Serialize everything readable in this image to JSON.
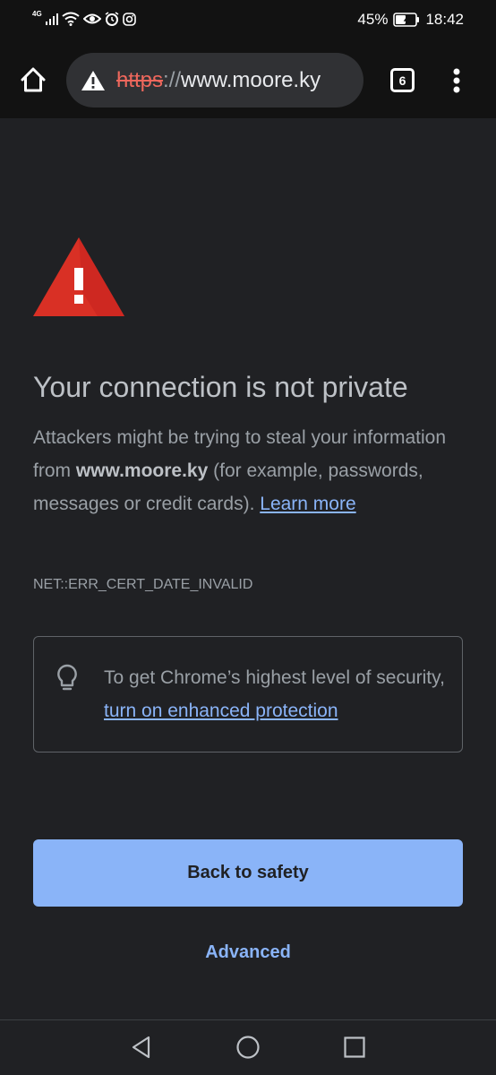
{
  "status_bar": {
    "network_type": "4G",
    "battery": "45%",
    "time": "18:42"
  },
  "toolbar": {
    "url_scheme": "https",
    "url_separator": "://",
    "url_host": "www.moore.ky",
    "tab_count": "6"
  },
  "page": {
    "heading": "Your connection is not private",
    "body_before": "Attackers might be trying to steal your information from ",
    "body_domain": "www.moore.ky",
    "body_after": " (for example, passwords, messages or credit cards). ",
    "learn_more": "Learn more",
    "error_code": "NET::ERR_CERT_DATE_INVALID",
    "tip_text": "To get Chrome’s highest level of security, ",
    "tip_link": "turn on enhanced protection",
    "back_button": "Back to safety",
    "advanced": "Advanced"
  },
  "colors": {
    "background": "#202124",
    "warning_red": "#d93025",
    "link_blue": "#8ab4f8"
  },
  "icons": {
    "home": "home-icon",
    "not_secure": "warning-triangle-icon",
    "menu": "more-vertical-icon",
    "tip": "lightbulb-icon",
    "nav_back": "triangle-back-icon",
    "nav_home": "circle-home-icon",
    "nav_recents": "square-recents-icon"
  }
}
